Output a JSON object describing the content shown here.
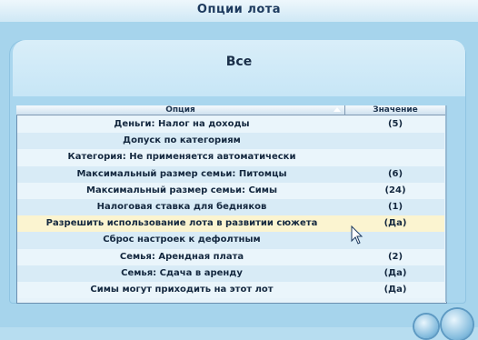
{
  "window": {
    "title": "Опции лота"
  },
  "heading": "Все",
  "table": {
    "columns": {
      "option": "Опция",
      "value": "Значение"
    },
    "rows": [
      {
        "option": "Деньги: Налог на доходы",
        "value": "(5)"
      },
      {
        "option": "Допуск по категориям",
        "value": ""
      },
      {
        "option": "Категория: Не применяется автоматически",
        "value": ""
      },
      {
        "option": "Максимальный размер семьи: Питомцы",
        "value": "(6)"
      },
      {
        "option": "Максимальный размер семьи: Симы",
        "value": "(24)"
      },
      {
        "option": "Налоговая ставка для бедняков",
        "value": "(1)"
      },
      {
        "option": "Разрешить использование лота в развитии сюжета",
        "value": "(Да)",
        "selected": true
      },
      {
        "option": "Сброс настроек к дефолтным",
        "value": ""
      },
      {
        "option": "Семья: Арендная плата",
        "value": "(2)"
      },
      {
        "option": "Семья: Сдача в аренду",
        "value": "(Да)"
      },
      {
        "option": "Симы могут приходить на этот лот",
        "value": "(Да)"
      }
    ]
  },
  "colors": {
    "background": "#b7ddf0",
    "selected_row": "#fbf4d0",
    "text": "#14283f"
  },
  "icons": [
    "sort-ascending-icon",
    "mouse-cursor-icon"
  ]
}
